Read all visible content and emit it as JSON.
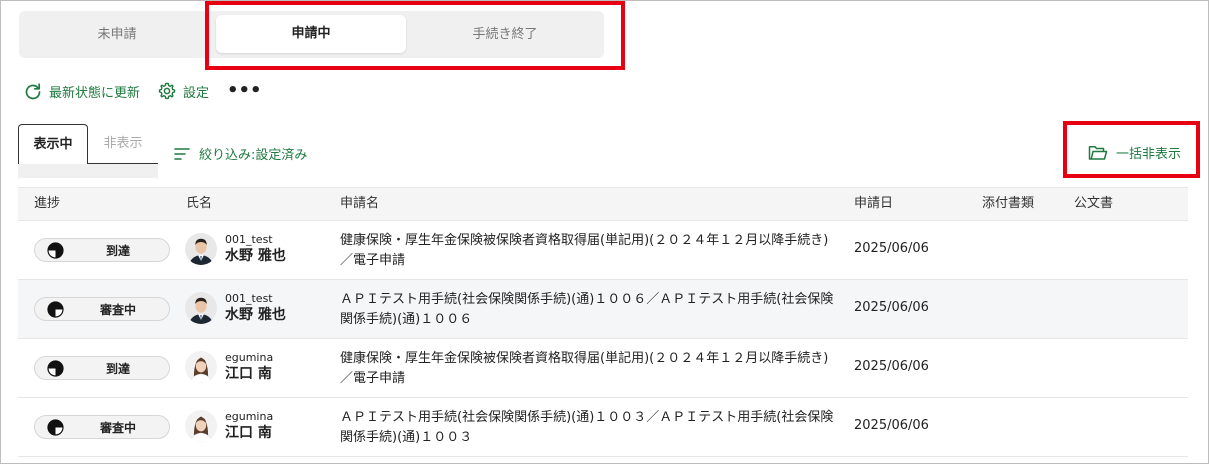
{
  "status_tabs": [
    "未申請",
    "申請中",
    "手続き終了"
  ],
  "toolbar": {
    "refresh_label": "最新状態に更新",
    "settings_label": "設定",
    "more_label": "•••"
  },
  "visibility_tabs": {
    "shown": "表示中",
    "hidden": "非表示"
  },
  "filter_label": "絞り込み:設定済み",
  "bulk_hide_label": "一括非表示",
  "table": {
    "headers": {
      "progress": "進捗",
      "name": "氏名",
      "application": "申請名",
      "date": "申請日",
      "attachments": "添付書類",
      "official_doc": "公文書"
    },
    "rows": [
      {
        "status": "到達",
        "user_id": "001_test",
        "name": "水野 雅也",
        "application": "健康保険・厚生年金保険被保険者資格取得届(単記用)(２０２４年１２月以降手続き)／電子申請",
        "date": "2025/06/06"
      },
      {
        "status": "審査中",
        "user_id": "001_test",
        "name": "水野 雅也",
        "application": "ＡＰＩテスト用手続(社会保険関係手続)(通)１００６／ＡＰＩテスト用手続(社会保険関係手続)(通)１００６",
        "date": "2025/06/06"
      },
      {
        "status": "到達",
        "user_id": "egumina",
        "name": "江口 南",
        "application": "健康保険・厚生年金保険被保険者資格取得届(単記用)(２０２４年１２月以降手続き)／電子申請",
        "date": "2025/06/06"
      },
      {
        "status": "審査中",
        "user_id": "egumina",
        "name": "江口 南",
        "application": "ＡＰＩテスト用手続(社会保険関係手続)(通)１００３／ＡＰＩテスト用手続(社会保険関係手続)(通)１００３",
        "date": "2025/06/06"
      }
    ]
  },
  "colors": {
    "accent_green": "#1e7a3f",
    "highlight_red": "#e60012"
  }
}
